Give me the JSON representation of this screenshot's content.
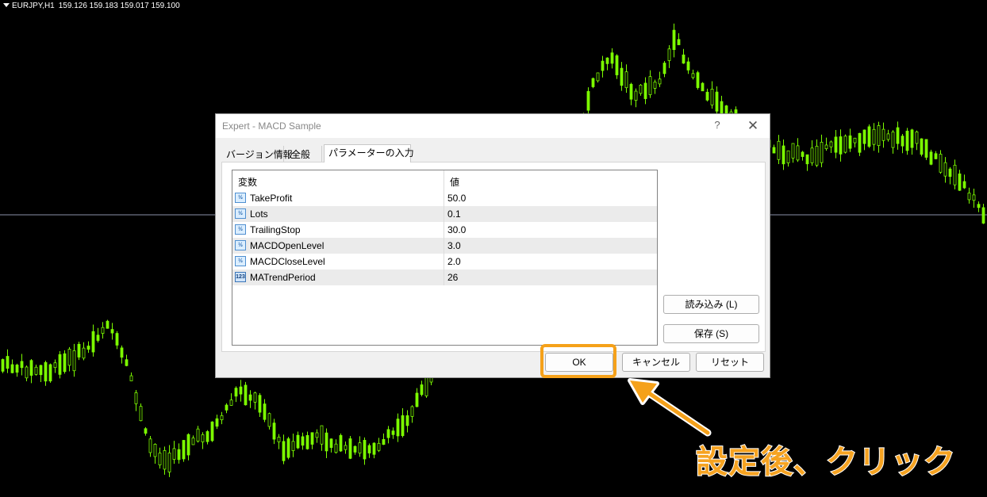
{
  "chart": {
    "title_symbol": "EURJPY,H1",
    "title_prices": "159.126 159.183 159.017 159.100",
    "bg_color": "#000000",
    "candle_color": "#7CFC00"
  },
  "dialog": {
    "title": "Expert - MACD Sample",
    "help_label": "?",
    "close_label": "✕",
    "tabs": [
      {
        "label": "バージョン情報"
      },
      {
        "label": "全般"
      },
      {
        "label": "パラメーターの入力",
        "active": true
      }
    ],
    "table": {
      "col_variable": "変数",
      "col_value": "値",
      "rows": [
        {
          "icon": "decimal-icon",
          "name": "TakeProfit",
          "value": "50.0"
        },
        {
          "icon": "decimal-icon",
          "name": "Lots",
          "value": "0.1"
        },
        {
          "icon": "decimal-icon",
          "name": "TrailingStop",
          "value": "30.0"
        },
        {
          "icon": "decimal-icon",
          "name": "MACDOpenLevel",
          "value": "3.0"
        },
        {
          "icon": "decimal-icon",
          "name": "MACDCloseLevel",
          "value": "2.0"
        },
        {
          "icon": "integer-icon",
          "name": "MATrendPeriod",
          "value": "26"
        }
      ]
    },
    "load_label": "読み込み (L)",
    "save_label": "保存 (S)",
    "ok_label": "OK",
    "cancel_label": "キャンセル",
    "reset_label": "リセット"
  },
  "annotation": {
    "text": "設定後、クリック",
    "color": "#F5A11A"
  }
}
